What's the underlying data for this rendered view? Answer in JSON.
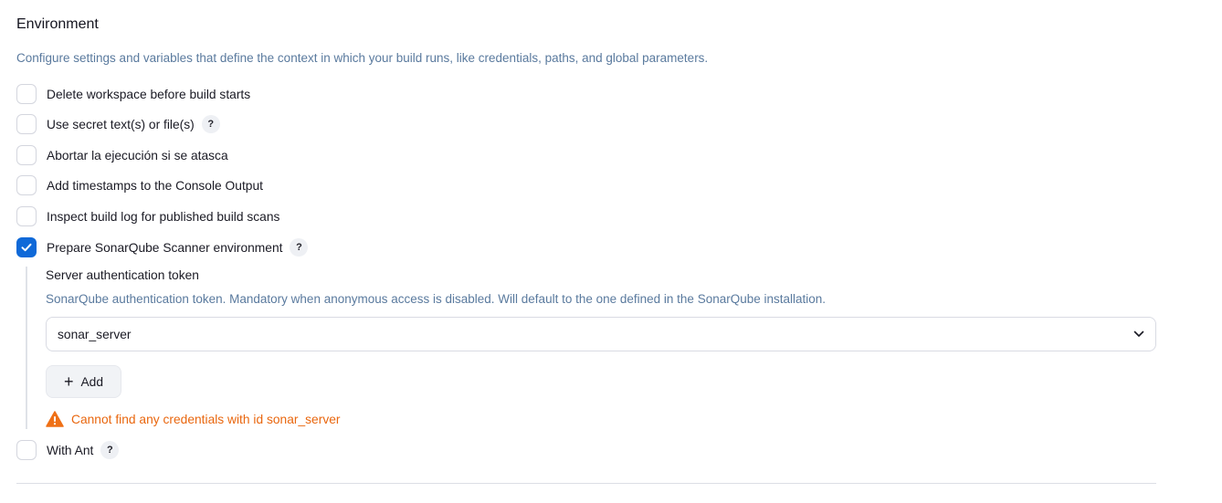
{
  "section": {
    "title": "Environment",
    "description": "Configure settings and variables that define the context in which your build runs, like credentials, paths, and global parameters."
  },
  "options": [
    {
      "label": "Delete workspace before build starts",
      "checked": false,
      "help": false
    },
    {
      "label": "Use secret text(s) or file(s)",
      "checked": false,
      "help": true
    },
    {
      "label": "Abortar la ejecución si se atasca",
      "checked": false,
      "help": false
    },
    {
      "label": "Add timestamps to the Console Output",
      "checked": false,
      "help": false
    },
    {
      "label": "Inspect build log for published build scans",
      "checked": false,
      "help": false
    },
    {
      "label": "Prepare SonarQube Scanner environment",
      "checked": true,
      "help": true
    },
    {
      "label": "With Ant",
      "checked": false,
      "help": true
    }
  ],
  "help_glyph": "?",
  "sonar": {
    "token_label": "Server authentication token",
    "token_description": "SonarQube authentication token. Mandatory when anonymous access is disabled. Will default to the one defined in the SonarQube installation.",
    "selected_credential": "sonar_server",
    "add_label": "Add",
    "add_icon": "+",
    "warning": "Cannot find any credentials with id sonar_server"
  },
  "colors": {
    "accent": "#0f69d8",
    "warning": "#e9670f",
    "description": "#5a7a9e"
  }
}
